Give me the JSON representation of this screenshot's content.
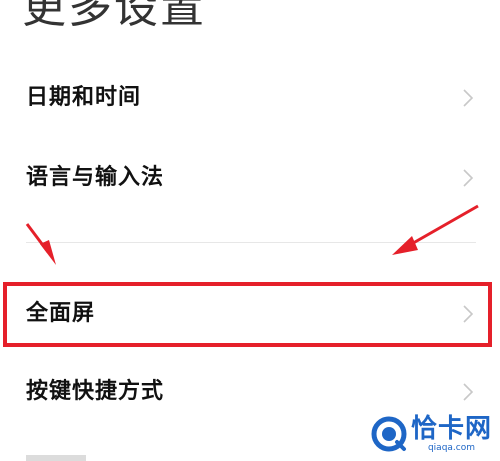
{
  "page": {
    "title": "更多设置"
  },
  "menu": {
    "items": [
      {
        "label": "日期和时间",
        "icon": "chevron-right-icon"
      },
      {
        "label": "语言与输入法",
        "icon": "chevron-right-icon"
      },
      {
        "label": "全面屏",
        "icon": "chevron-right-icon",
        "highlighted": true
      },
      {
        "label": "按键快捷方式",
        "icon": "chevron-right-icon"
      }
    ]
  },
  "annotations": {
    "color": "#e5202a",
    "arrows": [
      "pointer-arrow-icon",
      "pointer-arrow-icon"
    ]
  },
  "watermark": {
    "name": "恰卡网",
    "url": "qiaqa.com",
    "color": "#1e66c6"
  }
}
